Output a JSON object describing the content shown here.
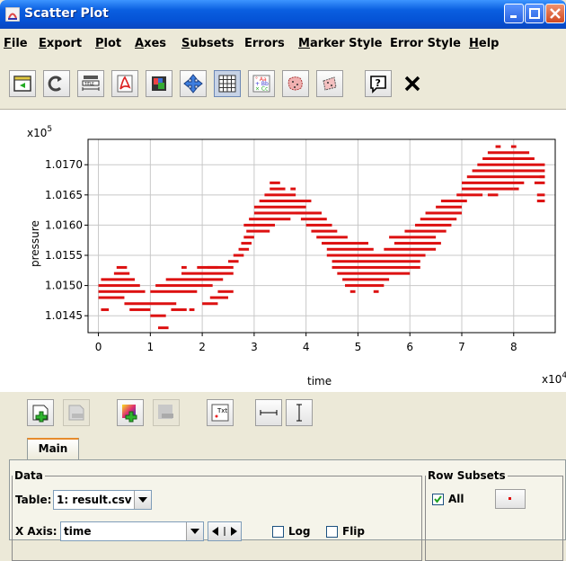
{
  "window": {
    "title": "Scatter Plot"
  },
  "menu": [
    {
      "label": "File",
      "key": "F",
      "rest": "ile"
    },
    {
      "label": "Export",
      "key": "E",
      "rest": "xport"
    },
    {
      "label": "Plot",
      "key": "P",
      "rest": "lot"
    },
    {
      "label": "Axes",
      "key": "A",
      "rest": "xes"
    },
    {
      "label": "Subsets",
      "key": "S",
      "rest": "ubsets"
    },
    {
      "label": "Errors",
      "key": "",
      "rest": "Errors"
    },
    {
      "label": "Marker Style",
      "key": "M",
      "rest": "arker Style"
    },
    {
      "label": "Error Style",
      "key": "",
      "rest": "Error Style"
    },
    {
      "label": "Help",
      "key": "H",
      "rest": "elp"
    }
  ],
  "toolbar_icons": [
    "sidebar-toggle-icon",
    "replot-icon",
    "title-icon",
    "pdf-export-icon",
    "image-export-icon",
    "pan-icon",
    "grid-icon",
    "legend-icon",
    "subset-icon",
    "zoom-region-icon",
    "help-icon",
    "close-icon"
  ],
  "plot": {
    "xlabel": "time",
    "ylabel": "pressure",
    "x_multiplier": "x10",
    "x_exp": "4",
    "y_multiplier": "x10",
    "y_exp": "5",
    "marker_color": "#DD1111"
  },
  "chart_data": {
    "type": "scatter",
    "xlabel": "time",
    "ylabel": "pressure",
    "x_scale": "x10^4",
    "y_scale": "x10^5",
    "xlim": [
      -0.2,
      8.8
    ],
    "ylim": [
      1.01422,
      1.01742
    ],
    "x_ticks": [
      "0",
      "1",
      "2",
      "3",
      "4",
      "5",
      "6",
      "7",
      "8"
    ],
    "y_ticks": [
      "1.0145",
      "1.0150",
      "1.0155",
      "1.0160",
      "1.0165",
      "1.0170"
    ],
    "grid": true,
    "series": [
      {
        "segments": [
          [
            0.0,
            0.5,
            1.0148
          ],
          [
            0.0,
            0.9,
            1.0149
          ],
          [
            0.0,
            0.8,
            1.015
          ],
          [
            0.05,
            0.7,
            1.0151
          ],
          [
            0.3,
            0.6,
            1.0152
          ],
          [
            0.35,
            0.55,
            1.0153
          ],
          [
            0.05,
            0.2,
            1.0146
          ],
          [
            0.6,
            1.0,
            1.0146
          ],
          [
            1.0,
            1.3,
            1.0145
          ],
          [
            1.15,
            1.35,
            1.0143
          ],
          [
            0.5,
            1.5,
            1.0147
          ],
          [
            1.0,
            1.9,
            1.0149
          ],
          [
            1.1,
            2.2,
            1.015
          ],
          [
            1.3,
            2.4,
            1.0151
          ],
          [
            1.6,
            2.6,
            1.0152
          ],
          [
            1.9,
            2.6,
            1.0153
          ],
          [
            1.4,
            1.7,
            1.0146
          ],
          [
            1.75,
            1.85,
            1.0146
          ],
          [
            2.0,
            2.3,
            1.0147
          ],
          [
            2.15,
            2.5,
            1.0148
          ],
          [
            2.3,
            2.6,
            1.0149
          ],
          [
            1.6,
            1.7,
            1.0153
          ],
          [
            2.1,
            2.3,
            1.0153
          ],
          [
            2.5,
            2.7,
            1.0154
          ],
          [
            2.6,
            2.8,
            1.0155
          ],
          [
            2.7,
            2.9,
            1.0156
          ],
          [
            2.75,
            2.95,
            1.0157
          ],
          [
            2.8,
            3.0,
            1.0158
          ],
          [
            2.85,
            3.3,
            1.0159
          ],
          [
            2.8,
            3.4,
            1.016
          ],
          [
            2.9,
            3.7,
            1.0161
          ],
          [
            3.0,
            4.0,
            1.0162
          ],
          [
            3.0,
            4.0,
            1.0163
          ],
          [
            3.1,
            4.1,
            1.0164
          ],
          [
            3.2,
            3.8,
            1.0165
          ],
          [
            3.3,
            3.6,
            1.0166
          ],
          [
            3.3,
            3.5,
            1.0167
          ],
          [
            3.7,
            3.8,
            1.0166
          ],
          [
            3.8,
            4.3,
            1.0162
          ],
          [
            3.9,
            4.4,
            1.0161
          ],
          [
            4.0,
            4.5,
            1.016
          ],
          [
            4.1,
            4.6,
            1.0159
          ],
          [
            4.2,
            4.8,
            1.0158
          ],
          [
            4.3,
            5.2,
            1.0157
          ],
          [
            4.4,
            5.3,
            1.0156
          ],
          [
            4.4,
            5.3,
            1.0155
          ],
          [
            4.5,
            6.2,
            1.0154
          ],
          [
            4.5,
            6.2,
            1.0153
          ],
          [
            4.6,
            6.0,
            1.0152
          ],
          [
            4.7,
            5.6,
            1.0151
          ],
          [
            4.75,
            5.5,
            1.015
          ],
          [
            4.85,
            4.95,
            1.0149
          ],
          [
            5.3,
            5.4,
            1.0149
          ],
          [
            5.2,
            6.3,
            1.0155
          ],
          [
            5.5,
            6.5,
            1.0156
          ],
          [
            5.7,
            6.6,
            1.0157
          ],
          [
            5.6,
            6.5,
            1.0158
          ],
          [
            5.9,
            6.7,
            1.0159
          ],
          [
            6.1,
            6.8,
            1.016
          ],
          [
            6.2,
            6.9,
            1.0161
          ],
          [
            6.3,
            7.0,
            1.0162
          ],
          [
            6.5,
            7.0,
            1.0163
          ],
          [
            6.6,
            7.1,
            1.0164
          ],
          [
            6.9,
            7.4,
            1.0165
          ],
          [
            7.0,
            8.0,
            1.0166
          ],
          [
            7.0,
            8.2,
            1.0167
          ],
          [
            7.1,
            8.6,
            1.0168
          ],
          [
            7.2,
            8.6,
            1.0169
          ],
          [
            7.3,
            8.6,
            1.017
          ],
          [
            7.4,
            8.4,
            1.0171
          ],
          [
            7.5,
            8.3,
            1.0172
          ],
          [
            7.65,
            7.75,
            1.0173
          ],
          [
            7.95,
            8.05,
            1.0173
          ],
          [
            8.5,
            8.6,
            1.0168
          ],
          [
            8.4,
            8.6,
            1.0167
          ],
          [
            8.45,
            8.6,
            1.0165
          ],
          [
            8.45,
            8.6,
            1.0164
          ],
          [
            7.5,
            7.7,
            1.0165
          ],
          [
            8.0,
            8.1,
            1.0166
          ]
        ]
      }
    ]
  },
  "toolbar2_icons": [
    "add-plot-layer-icon",
    "remove-plot-layer-icon",
    "add-density-layer-icon",
    "remove-density-layer-icon",
    "add-text-layer-icon",
    "horizontal-line-icon",
    "vertical-line-icon"
  ],
  "panel": {
    "tab": "Main",
    "data_legend": "Data",
    "table_label": "Table:",
    "table_value": "1: result.csv",
    "xaxis_label": "X Axis:",
    "xaxis_value": "time",
    "log_label": "Log",
    "flip_label": "Flip",
    "row_subsets_legend": "Row Subsets",
    "all_label": "All",
    "all_checked": true
  }
}
